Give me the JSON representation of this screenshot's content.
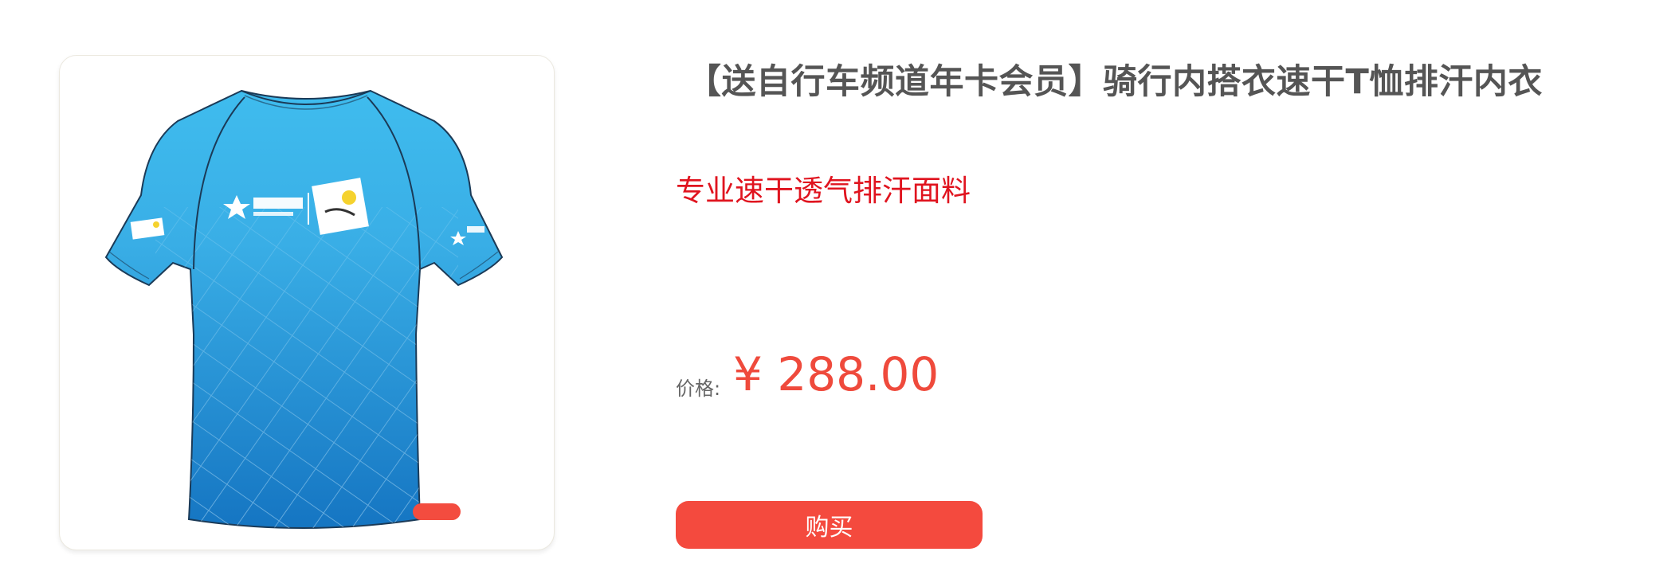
{
  "product": {
    "title": "【送自行车频道年卡会员】骑行内搭衣速干T恤排汗内衣",
    "subtitle": "专业速干透气排汗面料",
    "price_label": "价格:",
    "price_value": "¥ 288.00",
    "buy_label": "购买"
  },
  "image": {
    "description_icon": "blue-cycling-tshirt-image",
    "carousel": {
      "slides_visible": 1,
      "active_index": 0
    }
  },
  "colors": {
    "accent": "#f44a3e",
    "subtitle": "#e0141f",
    "shirt_light": "#3fbcee",
    "shirt_dark": "#1677c4"
  }
}
